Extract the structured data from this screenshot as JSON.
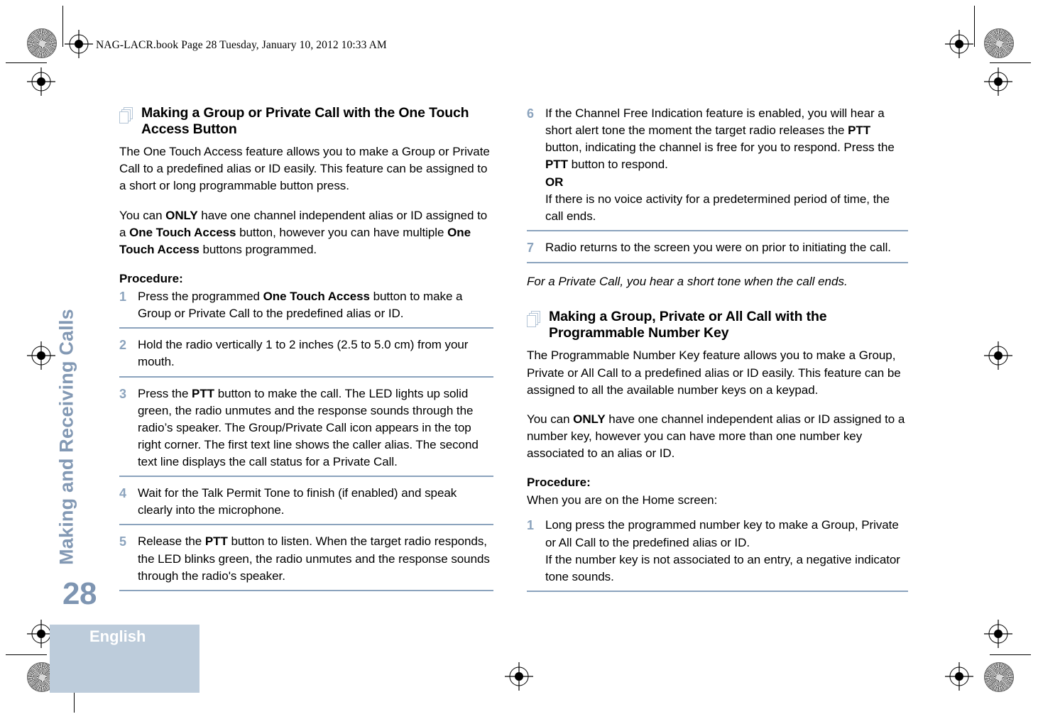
{
  "header": {
    "slug": "NAG-LACR.book  Page 28  Tuesday, January 10, 2012  10:33 AM"
  },
  "sidebar": {
    "chapter_title": "Making and Receiving Calls",
    "page_number": "28",
    "language": "English"
  },
  "colors": {
    "accent_rule": "#8ba3bd",
    "step_number": "#8ba3bd",
    "chapter_title": "#8399b4",
    "page_number": "#7e95b2",
    "language_block": "#bdccdb",
    "icon_outline": "#b3c4d6"
  },
  "left_column": {
    "section": {
      "icon": "pages-stack-icon",
      "heading": "Making a Group or Private Call with the One Touch Access Button",
      "paragraphs": [
        "The One Touch Access feature allows you to make a Group or Private Call to a predefined alias or ID easily. This feature can be assigned to a short or long programmable button press.",
        "You can ONLY have one channel independent alias or ID assigned to a One Touch Access button, however you can have multiple One Touch Access buttons programmed."
      ],
      "procedure_label": "Procedure:",
      "steps": [
        {
          "num": "1",
          "text": "Press the programmed One Touch Access button to make a Group or Private Call to the predefined alias or ID."
        },
        {
          "num": "2",
          "text": "Hold the radio vertically 1 to 2 inches (2.5 to 5.0 cm) from your mouth."
        },
        {
          "num": "3",
          "text": "Press the PTT button to make the call. The LED lights up solid green, the radio unmutes and the response sounds through the radio’s speaker. The Group/Private Call icon appears in the top right corner. The first text line shows the caller alias. The second text line displays the call status for a Private Call."
        },
        {
          "num": "4",
          "text": "Wait for the Talk Permit Tone to finish (if enabled) and speak clearly into the microphone."
        },
        {
          "num": "5",
          "text": "Release the PTT button to listen. When the target radio responds, the LED blinks green, the radio unmutes and the response sounds through the radio's speaker."
        }
      ]
    }
  },
  "right_column": {
    "continued_steps": [
      {
        "num": "6",
        "text": "If the Channel Free Indication feature is enabled, you will hear a short alert tone the moment the target radio releases the PTT button, indicating the channel is free for you to respond. Press the PTT button to respond.\nOR\nIf there is no voice activity for a predetermined period of time, the call ends."
      },
      {
        "num": "7",
        "text": "Radio returns to the screen you were on prior to initiating the call."
      }
    ],
    "note": "For a Private Call, you hear a short tone when the call ends.",
    "section": {
      "icon": "pages-stack-icon",
      "heading": "Making a Group, Private or All Call with the Programmable Number Key",
      "paragraphs": [
        "The Programmable Number Key feature allows you to make a Group, Private or All Call to a predefined alias or ID easily. This feature can be assigned to all the available number keys on a keypad.",
        "You can ONLY have one channel independent alias or ID assigned to a number key, however you can have more than one number key associated to an alias or ID."
      ],
      "procedure_label": "Procedure:",
      "procedure_lead_in": "When you are on the Home screen:",
      "steps": [
        {
          "num": "1",
          "text": "Long press the programmed number key to make a Group, Private or All Call to the predefined alias or ID.\nIf the number key is not associated to an entry, a negative indicator tone sounds."
        }
      ]
    }
  }
}
